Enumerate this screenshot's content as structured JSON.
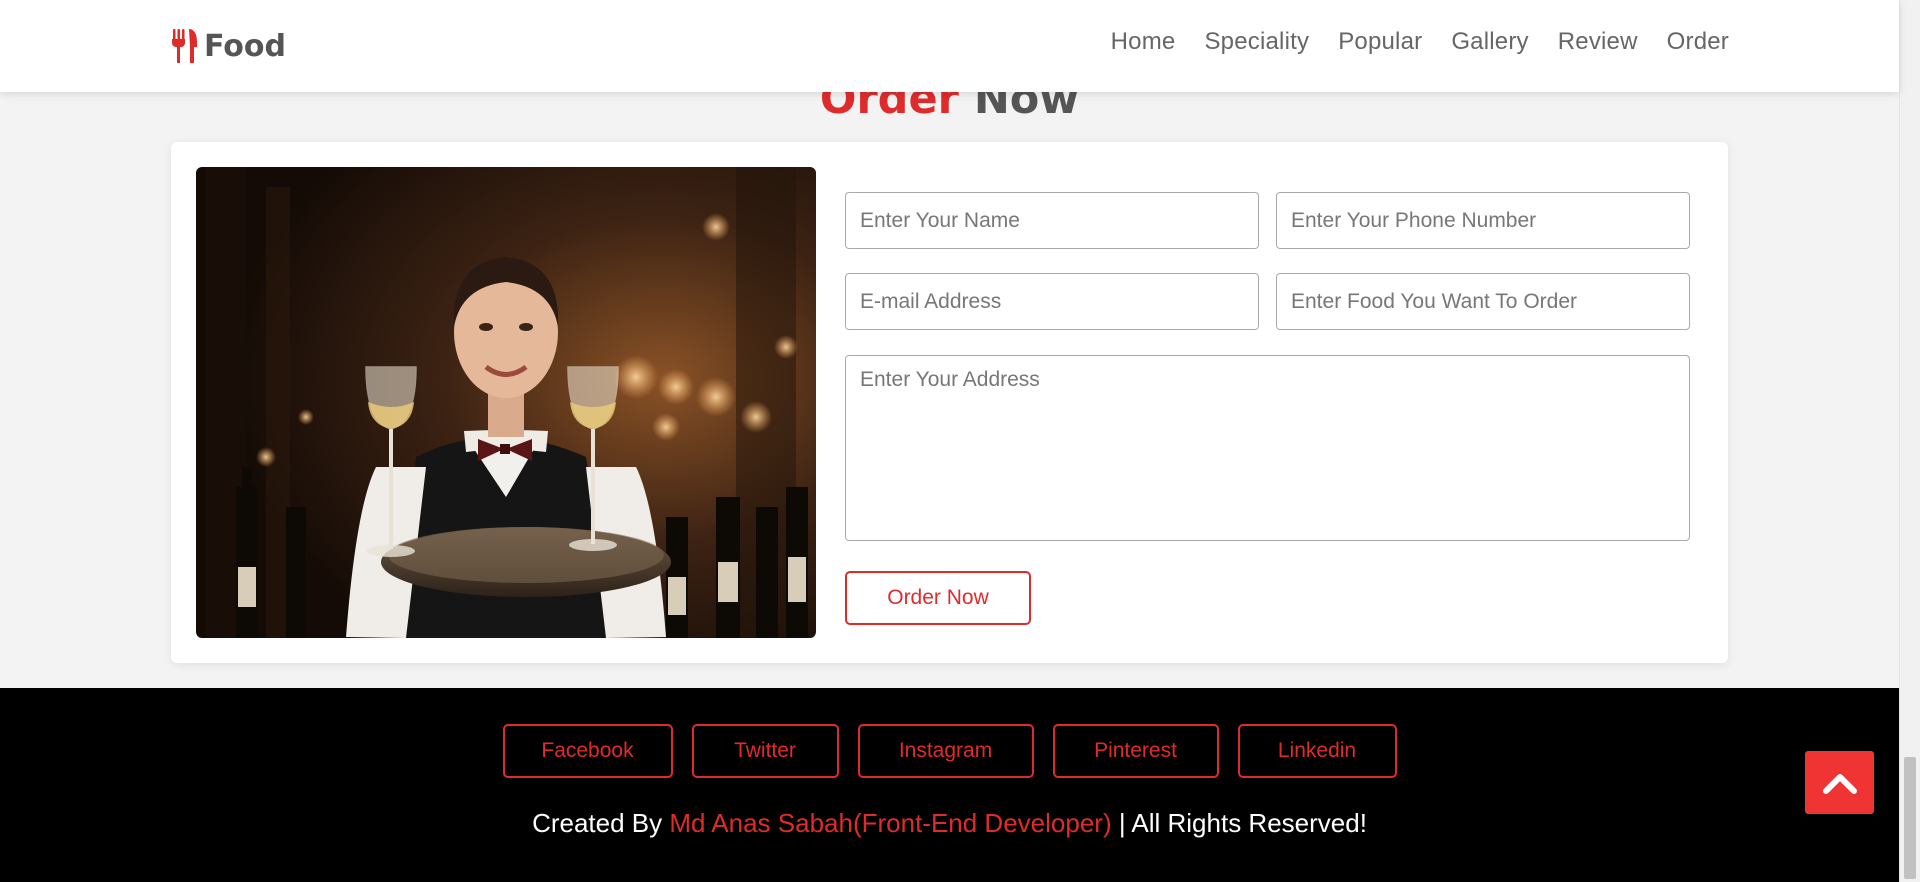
{
  "brand": {
    "name": "Food",
    "icon": "utensils-icon",
    "accent_color": "#e02b2b"
  },
  "nav": {
    "items": [
      {
        "label": "Home"
      },
      {
        "label": "Speciality"
      },
      {
        "label": "Popular"
      },
      {
        "label": "Gallery"
      },
      {
        "label": "Review"
      },
      {
        "label": "Order"
      }
    ]
  },
  "order_section": {
    "heading_accent": "Order",
    "heading_rest": "Now",
    "image_icon": "waitress-photo",
    "form": {
      "name_placeholder": "Enter Your Name",
      "phone_placeholder": "Enter Your Phone Number",
      "email_placeholder": "E-mail Address",
      "food_placeholder": "Enter Food You Want To Order",
      "address_placeholder": "Enter Your Address",
      "submit_label": "Order Now"
    }
  },
  "footer": {
    "social": [
      {
        "label": "Facebook"
      },
      {
        "label": "Twitter"
      },
      {
        "label": "Instagram"
      },
      {
        "label": "Pinterest"
      },
      {
        "label": "Linkedin"
      }
    ],
    "credit_prefix": "Created By ",
    "credit_author": "Md Anas Sabah(Front-End Developer)",
    "credit_suffix": " | All Rights Reserved!"
  },
  "scroll_top": {
    "icon": "chevron-up-icon",
    "color": "#f03333"
  }
}
